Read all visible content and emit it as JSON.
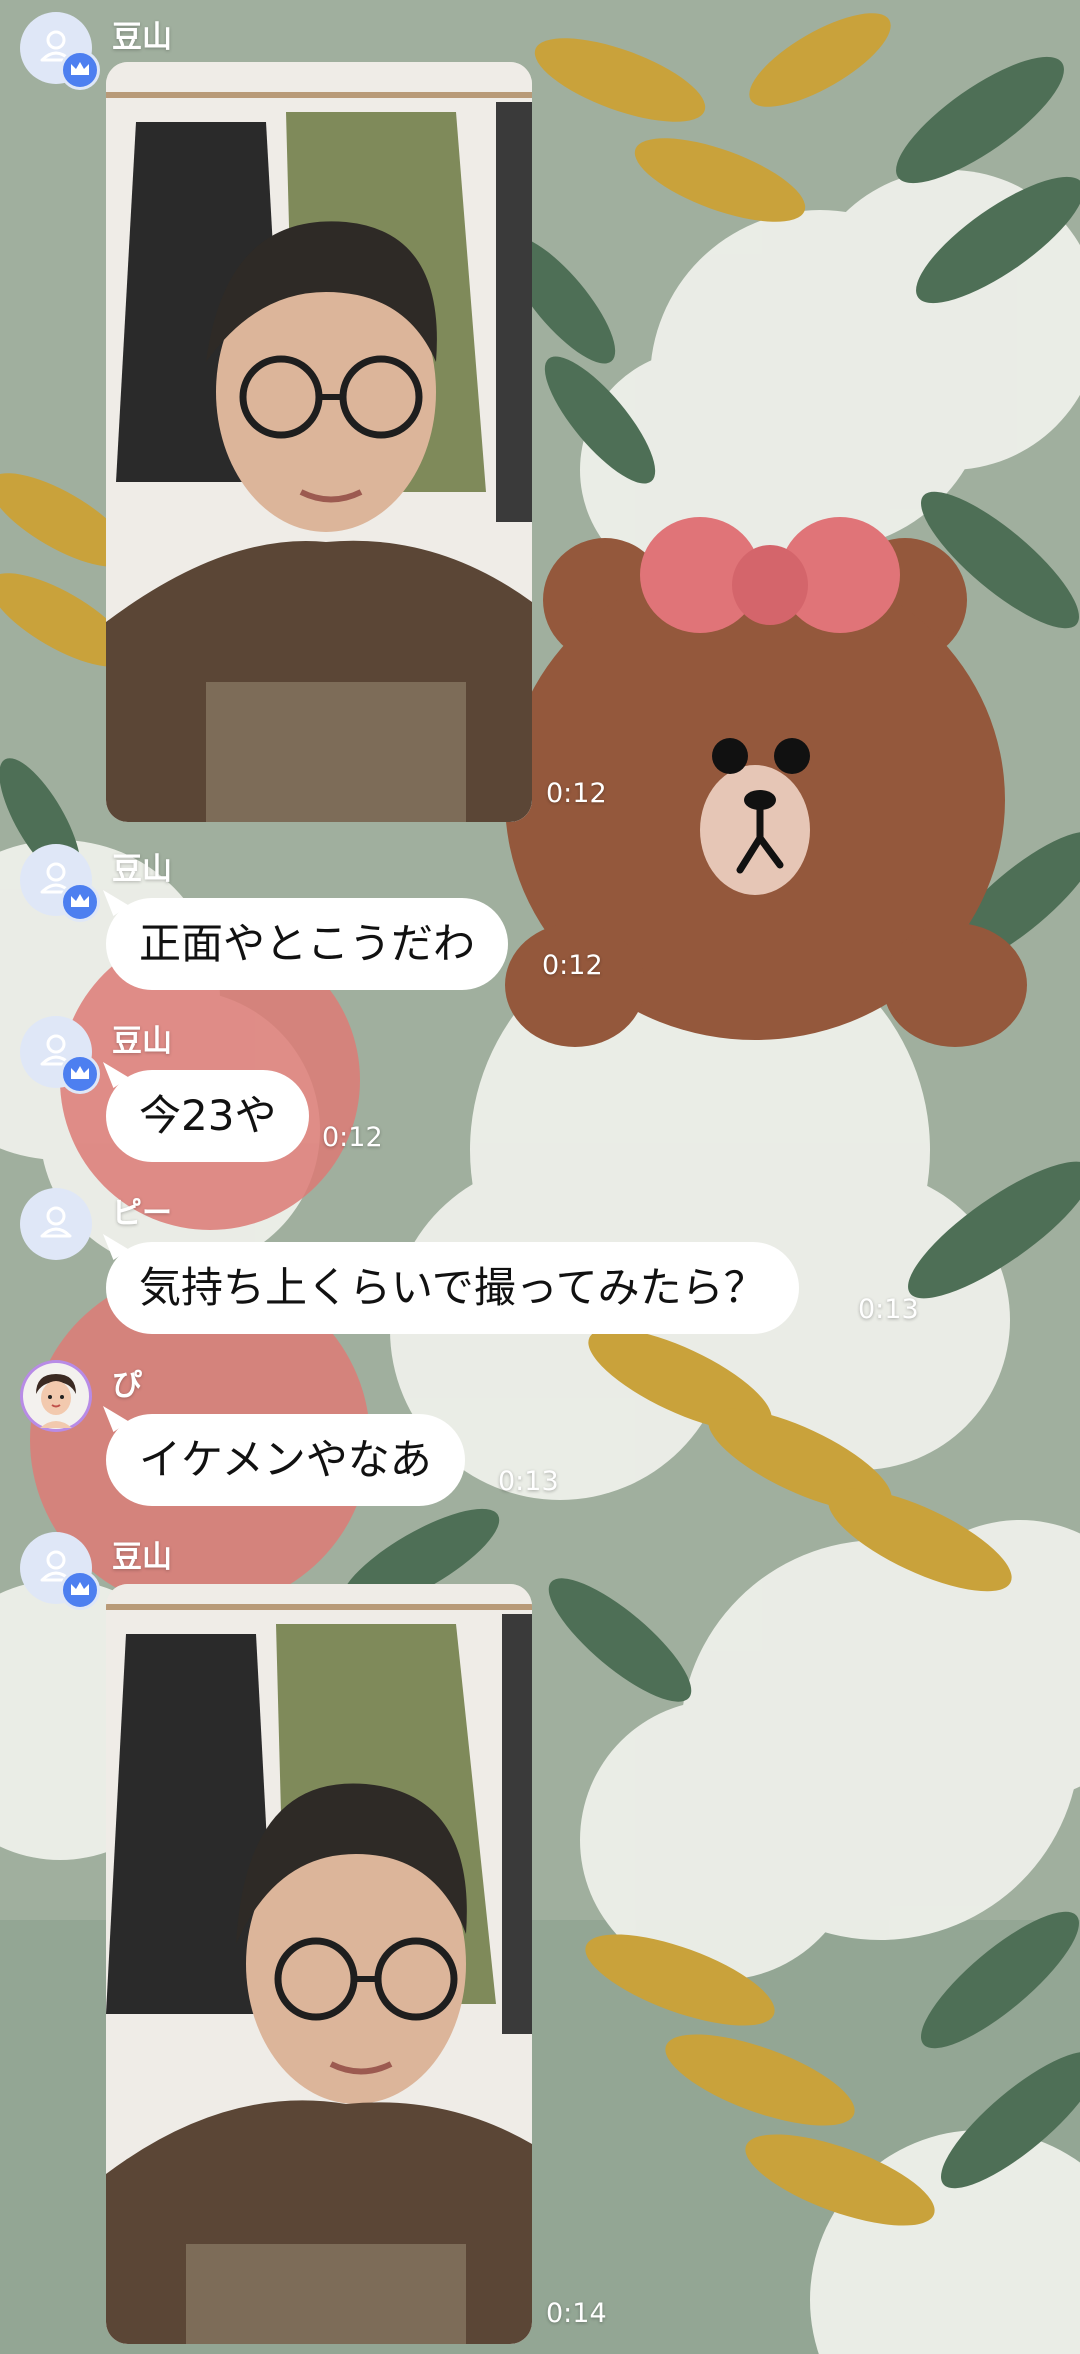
{
  "messages": [
    {
      "sender": "豆山",
      "type": "photo",
      "time": "0:12",
      "avatar_icon": "person-placeholder-icon",
      "badge_icon": "crown-icon"
    },
    {
      "sender": "豆山",
      "type": "text",
      "text": "正面やとこうだわ",
      "time": "0:12",
      "avatar_icon": "person-placeholder-icon",
      "badge_icon": "crown-icon"
    },
    {
      "sender": "豆山",
      "type": "text",
      "text": "今23や",
      "time": "0:12",
      "avatar_icon": "person-placeholder-icon",
      "badge_icon": "crown-icon"
    },
    {
      "sender": "ピー",
      "type": "text",
      "text": "気持ち上くらいで撮ってみたら？",
      "time": "0:13",
      "avatar_icon": "person-placeholder-icon"
    },
    {
      "sender": "ぴ",
      "type": "text",
      "text": "イケメンやなあ",
      "time": "0:13",
      "avatar_icon": "illustrated-avatar-icon"
    },
    {
      "sender": "豆山",
      "type": "photo",
      "time": "0:14",
      "avatar_icon": "person-placeholder-icon",
      "badge_icon": "crown-icon"
    }
  ],
  "colors": {
    "background": "#93a694",
    "bubble": "#ffffff",
    "avatar_bg": "#dfe7f7",
    "crown_badge": "#4d7ff0"
  }
}
